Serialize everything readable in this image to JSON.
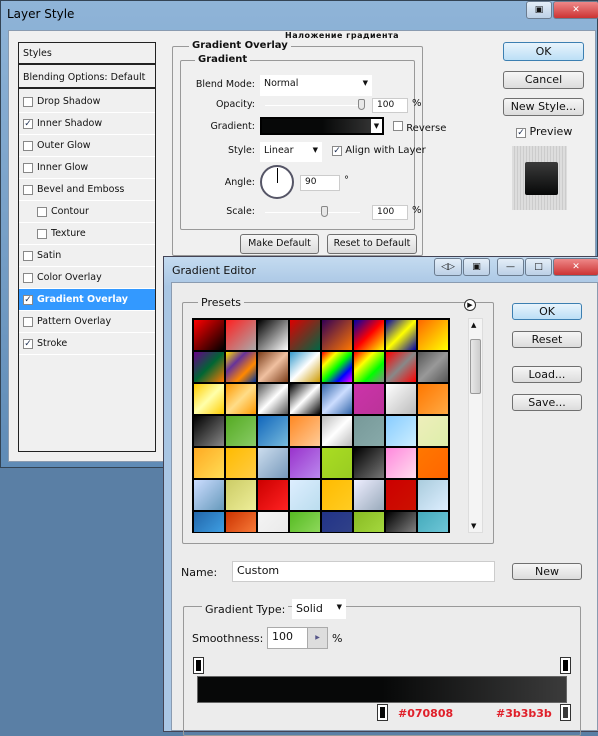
{
  "layer_style": {
    "title": "Layer Style",
    "section_ru": "Наложение градиента",
    "section": "Gradient Overlay",
    "group": "Gradient",
    "list_header": "Styles",
    "blending": "Blending Options: Default",
    "items": [
      {
        "label": "Drop Shadow",
        "checked": false
      },
      {
        "label": "Inner Shadow",
        "checked": true
      },
      {
        "label": "Outer Glow",
        "checked": false
      },
      {
        "label": "Inner Glow",
        "checked": false
      },
      {
        "label": "Bevel and Emboss",
        "checked": false
      },
      {
        "label": "Contour",
        "checked": false,
        "sub": true
      },
      {
        "label": "Texture",
        "checked": false,
        "sub": true
      },
      {
        "label": "Satin",
        "checked": false
      },
      {
        "label": "Color Overlay",
        "checked": false
      },
      {
        "label": "Gradient Overlay",
        "checked": true,
        "selected": true
      },
      {
        "label": "Pattern Overlay",
        "checked": false
      },
      {
        "label": "Stroke",
        "checked": true
      }
    ],
    "blend_mode_label": "Blend Mode:",
    "blend_mode": "Normal",
    "opacity_label": "Opacity:",
    "opacity": "100",
    "pct": "%",
    "gradient_label": "Gradient:",
    "reverse": "Reverse",
    "style_label": "Style:",
    "style": "Linear",
    "align": "Align with Layer",
    "angle_label": "Angle:",
    "angle": "90",
    "deg": "°",
    "scale_label": "Scale:",
    "scale": "100",
    "make_default": "Make Default",
    "reset_default": "Reset to Default",
    "ok": "OK",
    "cancel": "Cancel",
    "new_style": "New Style...",
    "preview": "Preview"
  },
  "gradient_editor": {
    "title": "Gradient Editor",
    "presets": "Presets",
    "ok": "OK",
    "reset": "Reset",
    "load": "Load...",
    "save": "Save...",
    "name_label": "Name:",
    "name": "Custom",
    "new": "New",
    "type_label": "Gradient Type:",
    "type": "Solid",
    "smooth_label": "Smoothness:",
    "smoothness": "100",
    "pct": "%",
    "stop_colors": [
      "#070808",
      "#3b3b3b"
    ],
    "presets_swatches": [
      [
        "#ff0000",
        "#000"
      ],
      [
        "#ff2020",
        "#aaa"
      ],
      [
        "#000",
        "#fff"
      ],
      [
        "#d00",
        "#064"
      ],
      [
        "#305",
        "#f70"
      ],
      [
        "#00a",
        "#f00",
        "#ff0"
      ],
      [
        "#00a",
        "#ff0",
        "#00a"
      ],
      [
        "#f60",
        "#ff0"
      ],
      [
        "#608",
        "#063",
        "#f70"
      ],
      [
        "#fd0",
        "#639",
        "#f80",
        "#039"
      ],
      [
        "#7a3d1a",
        "#f0c0a0",
        "#7a3d1a"
      ],
      [
        "#39c",
        "#fff",
        "#c90"
      ],
      [
        "#f00",
        "#ff0",
        "#0f0",
        "#00f",
        "#f0f"
      ],
      [
        "#f00",
        "#ff0",
        "#0f0",
        "#888"
      ],
      [
        "#f00",
        "#888",
        "#f00"
      ],
      [
        "#555",
        "#999",
        "#555"
      ],
      [
        "#fc0",
        "#ffa",
        "#fc0"
      ],
      [
        "#f90",
        "#fd8",
        "#f90"
      ],
      [
        "#555",
        "#fff",
        "#555"
      ],
      [
        "#000",
        "#fff",
        "#000"
      ],
      [
        "#36a",
        "#cdf",
        "#36a"
      ],
      [
        "#c3a",
        "#b39"
      ],
      [
        "#fff",
        "#bbb"
      ],
      [
        "#f70",
        "#fa4"
      ],
      [
        "#000",
        "#888"
      ],
      [
        "#5a2",
        "#8c6"
      ],
      [
        "#16b",
        "#7bd"
      ],
      [
        "#f82",
        "#fc9"
      ],
      [
        "#bbb",
        "#fff",
        "#bbb"
      ],
      [
        "#799",
        "#8aa"
      ],
      [
        "#8cf",
        "#cef"
      ],
      [
        "#eeb",
        "#dea"
      ],
      [
        "#fa2",
        "#fd5"
      ],
      [
        "#fb0",
        "#fc4"
      ],
      [
        "#cde",
        "#79b"
      ],
      [
        "#93c",
        "#b8e"
      ],
      [
        "#ad2",
        "#9c2"
      ],
      [
        "#000",
        "#777"
      ],
      [
        "#f8d",
        "#fde"
      ],
      [
        "#f70",
        "#f60"
      ],
      [
        "#cdf",
        "#69b"
      ],
      [
        "#cc6",
        "#ee9"
      ],
      [
        "#c00",
        "#f22"
      ],
      [
        "#def",
        "#bde"
      ],
      [
        "#fb0",
        "#fc2"
      ],
      [
        "#eef",
        "#9ab"
      ],
      [
        "#c00",
        "#c10"
      ],
      [
        "#acd",
        "#def"
      ],
      [
        "#26a",
        "#4ae"
      ],
      [
        "#c30",
        "#f84"
      ],
      [
        "#f4f4f4",
        "#e8e8e8"
      ],
      [
        "#5b2",
        "#9d6"
      ],
      [
        "#238",
        "#348"
      ],
      [
        "#8b2",
        "#ad4"
      ],
      [
        "#000",
        "#999"
      ],
      [
        "#4ab",
        "#7cd"
      ]
    ]
  }
}
